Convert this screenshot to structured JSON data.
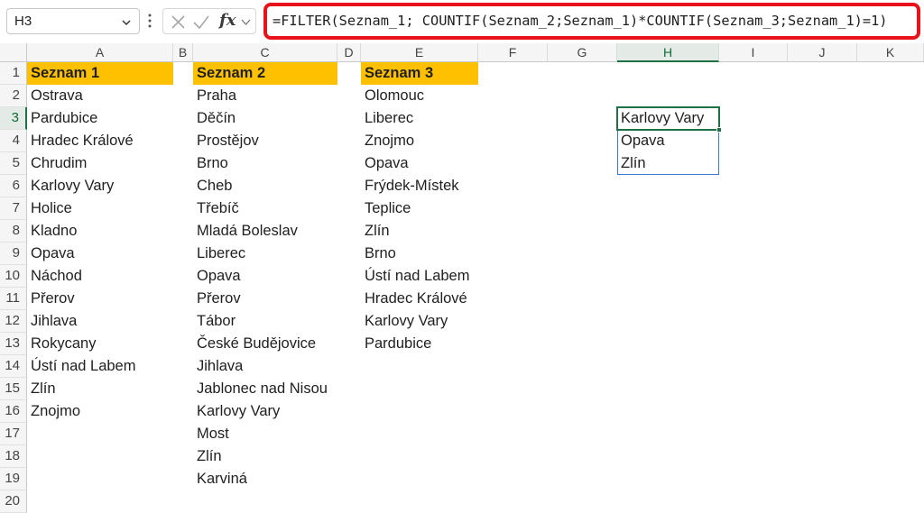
{
  "formula_bar": {
    "name_box": "H3",
    "fx_label": "fx",
    "formula": "=FILTER(Seznam_1; COUNTIF(Seznam_2;Seznam_1)*COUNTIF(Seznam_3;Seznam_1)=1)"
  },
  "columns": [
    "A",
    "B",
    "C",
    "D",
    "E",
    "F",
    "G",
    "H",
    "I",
    "J",
    "K"
  ],
  "rows": [
    "1",
    "2",
    "3",
    "4",
    "5",
    "6",
    "7",
    "8",
    "9",
    "10",
    "11",
    "12",
    "13",
    "14",
    "15",
    "16",
    "17",
    "18",
    "19",
    "20"
  ],
  "selected": {
    "column": "H",
    "row": "3"
  },
  "lists": {
    "seznam1": {
      "header": "Seznam 1",
      "items": [
        "Ostrava",
        "Pardubice",
        "Hradec Králové",
        "Chrudim",
        "Karlovy Vary",
        "Holice",
        "Kladno",
        "Opava",
        "Náchod",
        "Přerov",
        "Jihlava",
        "Rokycany",
        "Ústí nad Labem",
        "Zlín",
        "Znojmo"
      ]
    },
    "seznam2": {
      "header": "Seznam 2",
      "items": [
        "Praha",
        "Děčín",
        "Prostějov",
        "Brno",
        "Cheb",
        "Třebíč",
        "Mladá Boleslav",
        "Liberec",
        "Opava",
        "Přerov",
        "Tábor",
        "České Budějovice",
        "Jihlava",
        "Jablonec nad Nisou",
        "Karlovy Vary",
        "Most",
        "Zlín",
        "Karviná"
      ]
    },
    "seznam3": {
      "header": "Seznam 3",
      "items": [
        "Olomouc",
        "Liberec",
        "Znojmo",
        "Opava",
        "Frýdek-Místek",
        "Teplice",
        "Zlín",
        "Brno",
        "Ústí nad Labem",
        "Hradec Králové",
        "Karlovy Vary",
        "Pardubice"
      ]
    },
    "result": {
      "items": [
        "Karlovy Vary",
        "Opava",
        "Zlín"
      ]
    }
  },
  "colors": {
    "header_fill": "#ffc000",
    "formula_highlight": "#e8121a",
    "active_cell": "#1e7145",
    "spill_border": "#3a79d0"
  }
}
